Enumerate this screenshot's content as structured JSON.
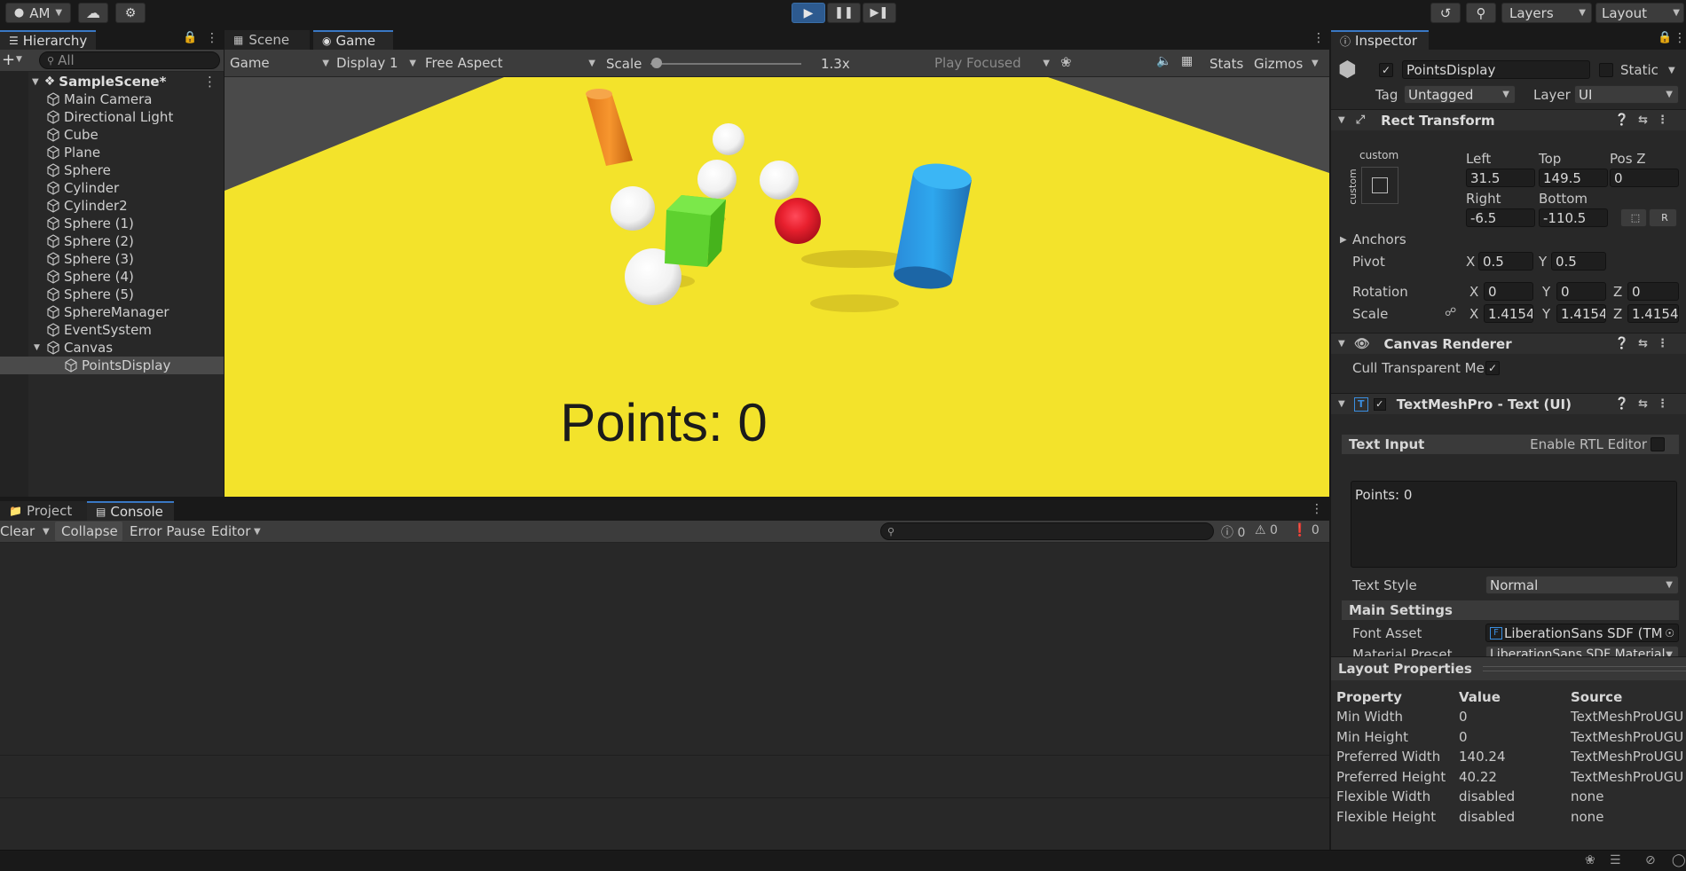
{
  "toolbar": {
    "account_label": "AM",
    "layers_label": "Layers",
    "layout_label": "Layout"
  },
  "hierarchy": {
    "tab_label": "Hierarchy",
    "search_placeholder": "All",
    "scene_name": "SampleScene*",
    "items": [
      {
        "label": "Main Camera",
        "depth": 1
      },
      {
        "label": "Directional Light",
        "depth": 1
      },
      {
        "label": "Cube",
        "depth": 1
      },
      {
        "label": "Plane",
        "depth": 1
      },
      {
        "label": "Sphere",
        "depth": 1
      },
      {
        "label": "Cylinder",
        "depth": 1
      },
      {
        "label": "Cylinder2",
        "depth": 1
      },
      {
        "label": "Sphere (1)",
        "depth": 1
      },
      {
        "label": "Sphere (2)",
        "depth": 1
      },
      {
        "label": "Sphere (3)",
        "depth": 1
      },
      {
        "label": "Sphere (4)",
        "depth": 1
      },
      {
        "label": "Sphere (5)",
        "depth": 1
      },
      {
        "label": "SphereManager",
        "depth": 1
      },
      {
        "label": "EventSystem",
        "depth": 1
      },
      {
        "label": "Canvas",
        "depth": 1,
        "expanded": true
      },
      {
        "label": "PointsDisplay",
        "depth": 2,
        "selected": true
      }
    ]
  },
  "view": {
    "tabs": [
      "Scene",
      "Game"
    ],
    "active_tab": "Game",
    "game_dropdown": "Game",
    "display_dropdown": "Display 1",
    "aspect_dropdown": "Free Aspect",
    "scale_label": "Scale",
    "scale_value": "1.3x",
    "scale_fraction": 0.0,
    "play_focused": "Play Focused",
    "stats_label": "Stats",
    "gizmos_label": "Gizmos",
    "points_text": "Points: 0"
  },
  "console": {
    "tabs": [
      "Project",
      "Console"
    ],
    "active_tab": "Console",
    "clear_label": "Clear",
    "collapse_label": "Collapse",
    "error_pause_label": "Error Pause",
    "editor_label": "Editor",
    "log_count": "0",
    "warn_count": "0",
    "error_count": "0"
  },
  "inspector": {
    "tab_label": "Inspector",
    "object_name": "PointsDisplay",
    "static_label": "Static",
    "tag_label": "Tag",
    "tag_value": "Untagged",
    "layer_label": "Layer",
    "layer_value": "UI",
    "rect_transform": {
      "title": "Rect Transform",
      "anchor_preset": "custom",
      "anchor_preset_side": "custom",
      "left_label": "Left",
      "left": "31.5",
      "top_label": "Top",
      "top": "149.5",
      "posz_label": "Pos Z",
      "posz": "0",
      "right_label": "Right",
      "right": "-6.5",
      "bottom_label": "Bottom",
      "bottom": "-110.5",
      "anchors_label": "Anchors",
      "pivot_label": "Pivot",
      "pivot_x": "0.5",
      "pivot_y": "0.5",
      "rotation_label": "Rotation",
      "rot_x": "0",
      "rot_y": "0",
      "rot_z": "0",
      "scale_label": "Scale",
      "scale_x": "1.4154",
      "scale_y": "1.4154",
      "scale_z": "1.4154",
      "x": "X",
      "y": "Y",
      "z": "Z"
    },
    "canvas_renderer": {
      "title": "Canvas Renderer",
      "cull_label": "Cull Transparent Me:"
    },
    "tmp": {
      "title": "TextMeshPro - Text (UI)",
      "text_input_label": "Text Input",
      "rtl_label": "Enable RTL Editor",
      "text_value": "Points: 0",
      "text_style_label": "Text Style",
      "text_style_value": "Normal",
      "main_settings_label": "Main Settings",
      "font_asset_label": "Font Asset",
      "font_asset_value": "LiberationSans SDF (TM",
      "material_preset_label": "Material Preset",
      "material_preset_value": "LiberationSans SDF Material"
    },
    "layout_properties": {
      "title": "Layout Properties",
      "headers": [
        "Property",
        "Value",
        "Source"
      ],
      "rows": [
        [
          "Min Width",
          "0",
          "TextMeshProUGU"
        ],
        [
          "Min Height",
          "0",
          "TextMeshProUGU"
        ],
        [
          "Preferred Width",
          "140.24",
          "TextMeshProUGU"
        ],
        [
          "Preferred Height",
          "40.22",
          "TextMeshProUGU"
        ],
        [
          "Flexible Width",
          "disabled",
          "none"
        ],
        [
          "Flexible Height",
          "disabled",
          "none"
        ]
      ]
    }
  },
  "colors": {
    "accent": "#3a78c4",
    "play_active": "#2d5a8f",
    "ground": "#f2e22a"
  }
}
